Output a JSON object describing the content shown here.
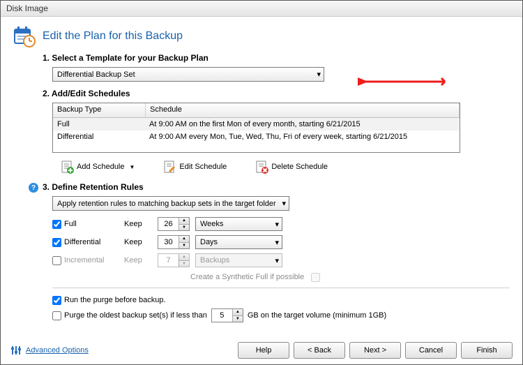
{
  "window": {
    "title": "Disk Image"
  },
  "header": {
    "title": "Edit the Plan for this Backup"
  },
  "section1": {
    "heading": "1. Select a Template for your Backup Plan",
    "selected_template": "Differential Backup Set"
  },
  "section2": {
    "heading": "2. Add/Edit Schedules",
    "columns": [
      "Backup Type",
      "Schedule"
    ],
    "rows": [
      {
        "type": "Full",
        "schedule": "At 9:00 AM on the first Mon of every month, starting 6/21/2015"
      },
      {
        "type": "Differential",
        "schedule": "At 9:00 AM every Mon, Tue, Wed, Thu, Fri of every week, starting 6/21/2015"
      }
    ],
    "buttons": {
      "add": "Add Schedule",
      "edit": "Edit Schedule",
      "delete": "Delete Schedule"
    }
  },
  "section3": {
    "heading": "3. Define Retention Rules",
    "rule_selected": "Apply retention rules to matching backup sets in the target folder",
    "keep_label": "Keep",
    "rows": [
      {
        "label": "Full",
        "checked": true,
        "value": "26",
        "unit": "Weeks",
        "enabled": true
      },
      {
        "label": "Differential",
        "checked": true,
        "value": "30",
        "unit": "Days",
        "enabled": true
      },
      {
        "label": "Incremental",
        "checked": false,
        "value": "7",
        "unit": "Backups",
        "enabled": false
      }
    ],
    "synthetic_label": "Create a Synthetic Full if possible",
    "purge": {
      "run_before": "Run the purge before backup.",
      "oldest_label": "Purge the oldest backup set(s) if less than",
      "gb_value": "5",
      "suffix": "GB on the target volume (minimum 1GB)"
    }
  },
  "footer": {
    "advanced": "Advanced Options",
    "buttons": [
      "Help",
      "< Back",
      "Next >",
      "Cancel",
      "Finish"
    ]
  }
}
